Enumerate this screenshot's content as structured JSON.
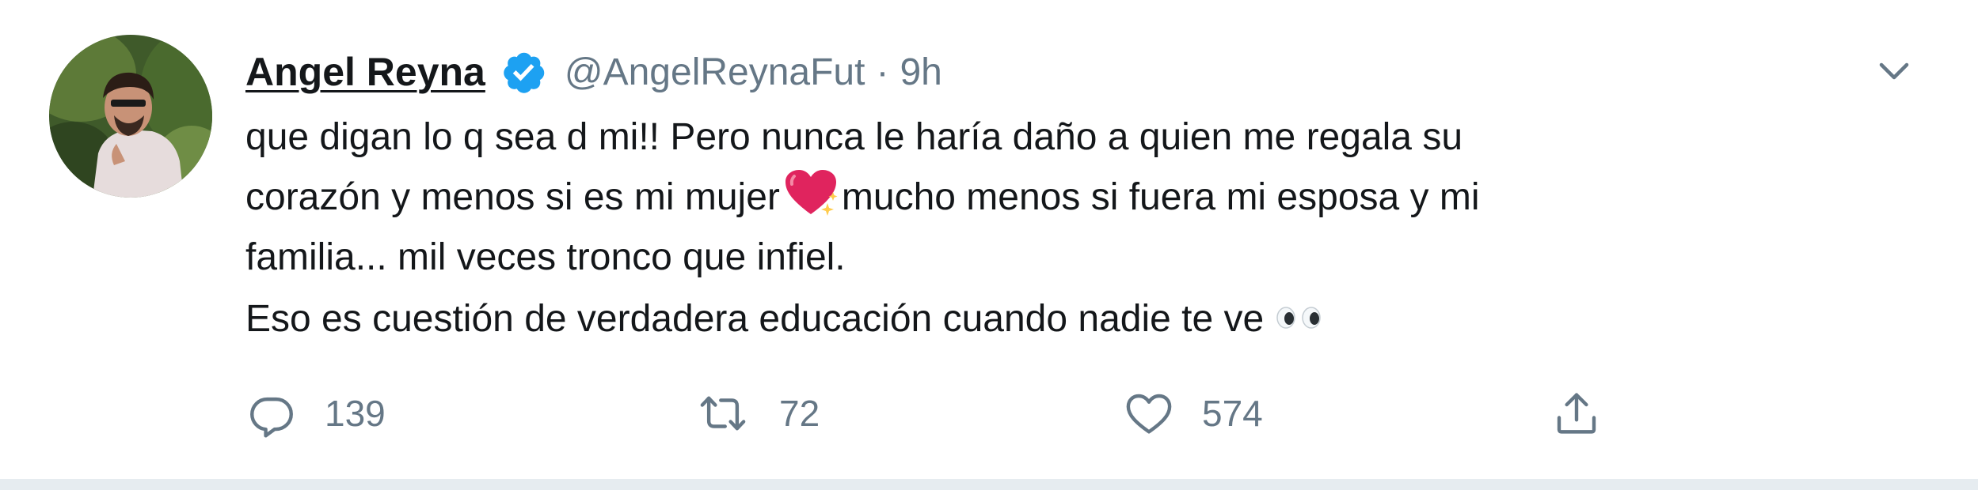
{
  "tweet": {
    "author_name": "Angel Reyna",
    "handle": "@AngelReynaFut",
    "separator": "·",
    "time": "9h",
    "lines": [
      "que digan lo q sea d mi!! Pero nunca le haría daño a quien me regala su",
      "corazón y menos si es mi mujer",
      "mucho menos si fuera mi esposa y mi",
      "familia... mil veces tronco que infiel.",
      "Eso es cuestión de verdadera educación cuando nadie te ve"
    ],
    "icons": {
      "verified": "verified-badge-icon",
      "heart_emoji": "sparkling-heart-emoji",
      "eyes_emoji": "eyes-emoji",
      "menu": "chevron-down-icon"
    }
  },
  "actions": {
    "reply_count": "139",
    "retweet_count": "72",
    "like_count": "574"
  },
  "colors": {
    "text": "#14171a",
    "secondary": "#657786",
    "verified_blue": "#1da1f2",
    "background": "#e6ecf0"
  }
}
